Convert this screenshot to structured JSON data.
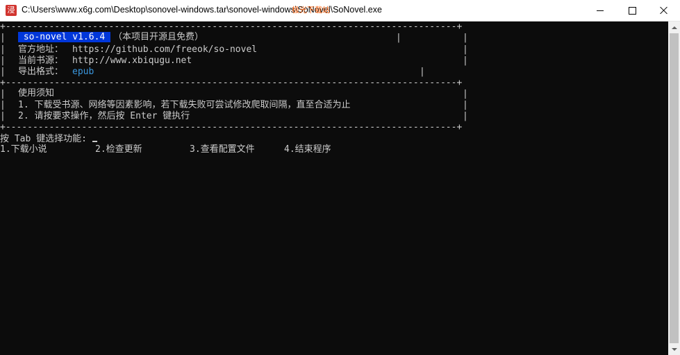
{
  "window": {
    "app_icon_glyph": "浸",
    "title": "C:\\Users\\www.x6g.com\\Desktop\\sonovel-windows.tar\\sonovel-windows\\SoNovel\\SoNovel.exe",
    "watermark": "极光下载站"
  },
  "console": {
    "border_top": "+-----------------------------------------------------------------------------------+",
    "border_mid": "+-----------------------------------------------------------------------------------+",
    "border_bottom": "+-----------------------------------------------------------------------------------+",
    "info": {
      "app_name": " so-novel v1.6.4 ",
      "open_source_note": "（本项目开源且免费）",
      "official_url_label": "官方地址：",
      "official_url": "https://github.com/freeok/so-novel",
      "source_label": "当前书源：",
      "source_url": "http://www.xbiqugu.net",
      "format_label": "导出格式：",
      "format_value": "epub"
    },
    "notice": {
      "title": "使用须知",
      "item1": "1. 下载受书源、网络等因素影响，若下载失败可尝试修改爬取间隔，直至合适为止",
      "item2": "2. 请按要求操作，然后按 Enter 键执行"
    },
    "prompt": "按 Tab 键选择功能: ",
    "menu": [
      "1.下载小说",
      "2.检查更新",
      "3.查看配置文件",
      "4.结束程序"
    ]
  },
  "colors": {
    "background": "#0c0c0c",
    "text": "#cccccc",
    "highlight_bg": "#0037da",
    "link_blue": "#3a96dd"
  },
  "icons": {
    "app": "sonovel-app-icon",
    "minimize": "minimize-icon",
    "maximize": "maximize-icon",
    "close": "close-icon",
    "scroll_up": "scroll-up-arrow-icon",
    "scroll_down": "scroll-down-arrow-icon"
  }
}
